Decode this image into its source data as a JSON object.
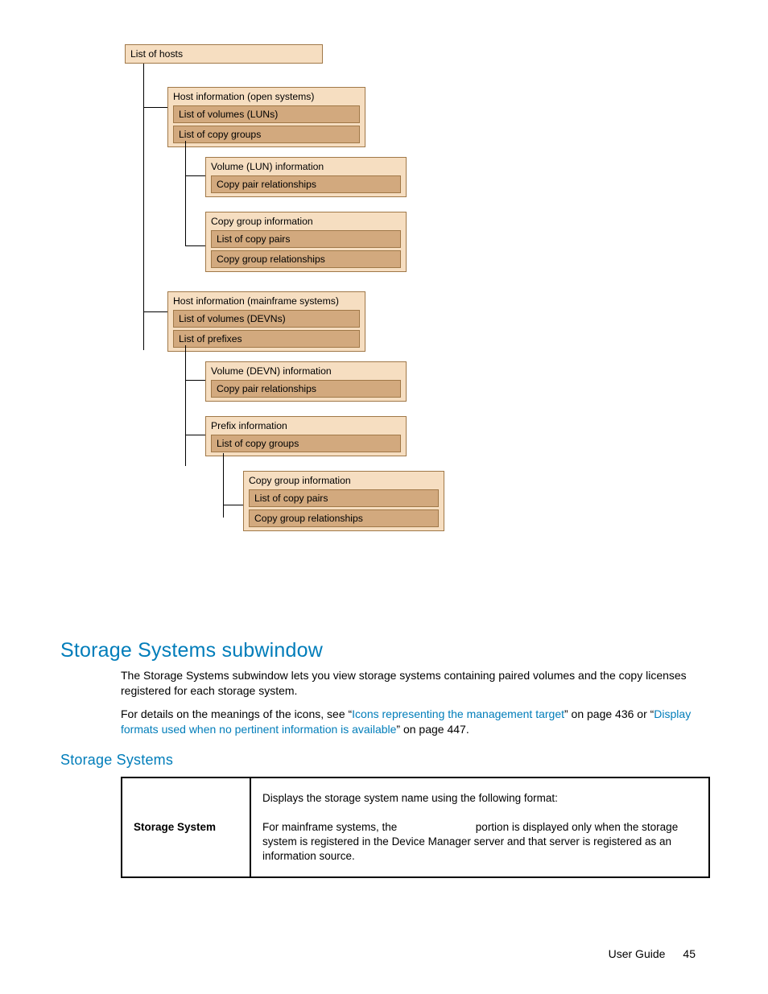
{
  "diagram": {
    "root": "List of hosts",
    "host_open": {
      "title": "Host information (open systems)",
      "items": [
        "List of volumes (LUNs)",
        "List of copy groups"
      ]
    },
    "vol_lun": {
      "title": "Volume (LUN) information",
      "items": [
        "Copy pair relationships"
      ]
    },
    "cg1": {
      "title": "Copy group information",
      "items": [
        "List of copy pairs",
        "Copy group relationships"
      ]
    },
    "host_mf": {
      "title": "Host information (mainframe systems)",
      "items": [
        "List of volumes (DEVNs)",
        "List of prefixes"
      ]
    },
    "vol_devn": {
      "title": "Volume (DEVN) information",
      "items": [
        "Copy pair relationships"
      ]
    },
    "prefix": {
      "title": "Prefix information",
      "items": [
        "List of copy groups"
      ]
    },
    "cg2": {
      "title": "Copy group information",
      "items": [
        "List of copy pairs",
        "Copy group relationships"
      ]
    }
  },
  "headings": {
    "h1": "Storage Systems subwindow",
    "h2": "Storage Systems"
  },
  "paragraphs": {
    "p1": "The Storage Systems subwindow lets you view storage systems containing paired volumes and the copy licenses registered for each storage system.",
    "p2a": "For details on the meanings of the icons, see “",
    "p2link1": "Icons representing the management target",
    "p2b": "” on page 436 or “",
    "p2link2": "Display formats used when no pertinent information is available",
    "p2c": "” on page 447."
  },
  "table": {
    "r0c0": "Storage System",
    "r0c1a": "Displays the storage system name using the following format:",
    "r0c1b": "For mainframe systems, the ",
    "r0c1c": " portion is displayed only when the storage system is registered in the Device Manager server and that server is registered as an information source."
  },
  "footer": {
    "label": "User Guide",
    "page": "45"
  }
}
